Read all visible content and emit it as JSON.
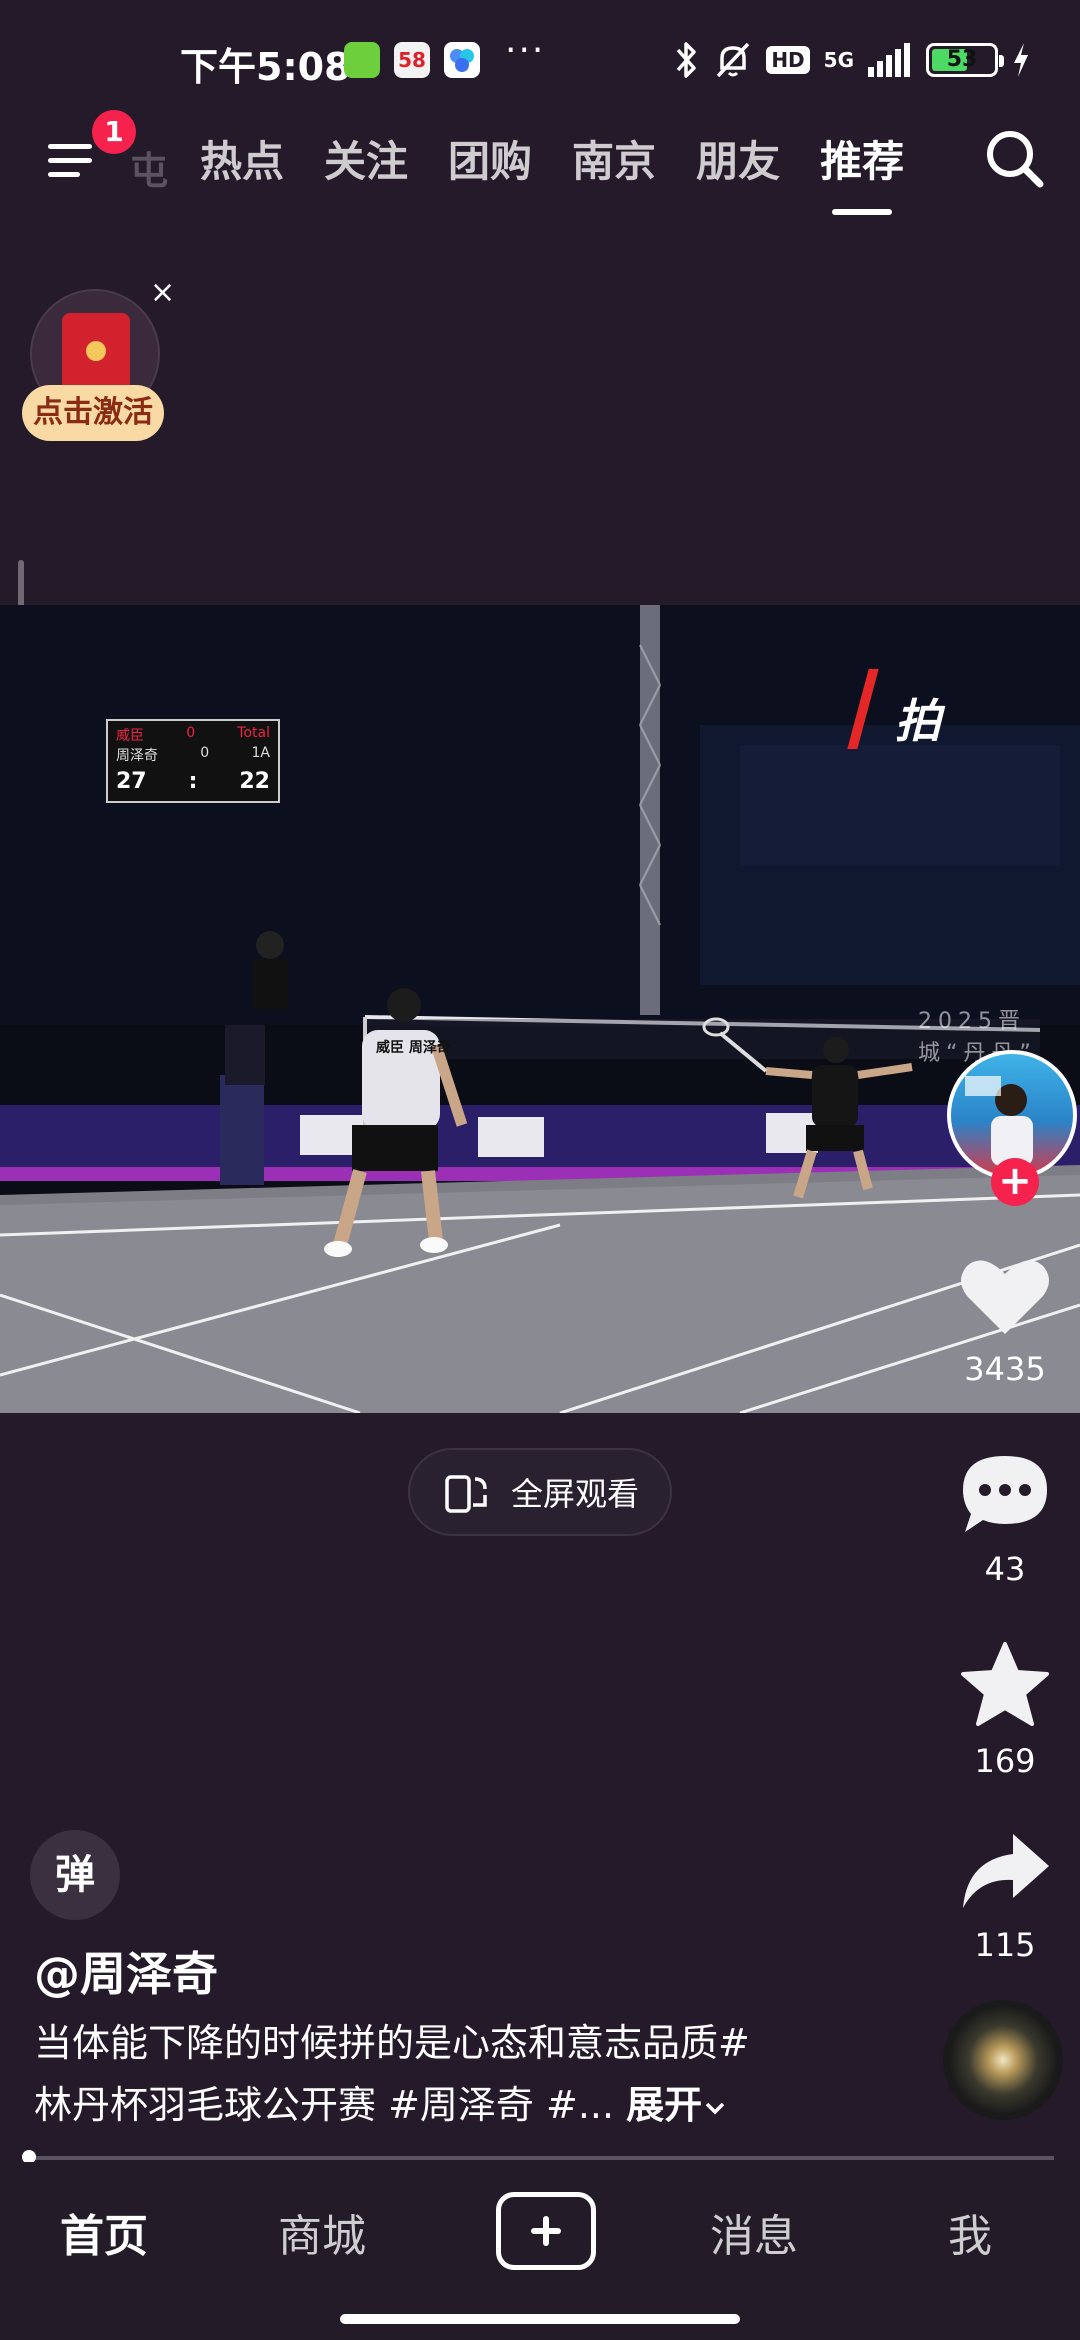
{
  "status_bar": {
    "time": "下午5:08",
    "app_icons": [
      {
        "name": "android-app-icon",
        "color": "#6ccf3b"
      },
      {
        "name": "58-app-icon",
        "color": "#f3f3f3",
        "text": "58"
      },
      {
        "name": "baidu-netdisk-icon",
        "color": "#4d8df7"
      }
    ],
    "more": "···",
    "network": "5G",
    "hd_label": "HD",
    "battery_level": "53",
    "battery_fraction": 0.53
  },
  "top_nav": {
    "menu_badge": "1",
    "faded_tab": "屯",
    "tabs": [
      {
        "label": "热点",
        "active": false
      },
      {
        "label": "关注",
        "active": false
      },
      {
        "label": "团购",
        "active": false
      },
      {
        "label": "南京",
        "active": false
      },
      {
        "label": "朋友",
        "active": false
      },
      {
        "label": "推荐",
        "active": true
      }
    ]
  },
  "red_packet": {
    "label": "点击激活",
    "close": "×"
  },
  "video": {
    "scoreboard": {
      "row1": [
        "威臣",
        "0",
        "Total"
      ],
      "row2": [
        "周泽奇",
        "0",
        "1A"
      ],
      "score_left": "27",
      "score_right": "22"
    },
    "overlay_text": "拍",
    "player_jersey": "威臣 周泽奇",
    "event_sign": "2025晋城“丹丹”"
  },
  "fullscreen": {
    "label": "全屏观看"
  },
  "right_rail": {
    "likes": "3435",
    "comments": "43",
    "favorites": "169",
    "shares": "115"
  },
  "caption": {
    "dan_label": "弹",
    "author": "@周泽奇",
    "line1": "当体能下降的时候拼的是心态和意志品质#",
    "line2": "林丹杯羽毛球公开赛 #周泽奇 #...",
    "expand": "展开"
  },
  "bottom_nav": {
    "items": [
      {
        "label": "首页",
        "active": true
      },
      {
        "label": "商城",
        "active": false
      },
      {
        "label": "消息",
        "active": false
      },
      {
        "label": "我",
        "active": false
      }
    ]
  }
}
